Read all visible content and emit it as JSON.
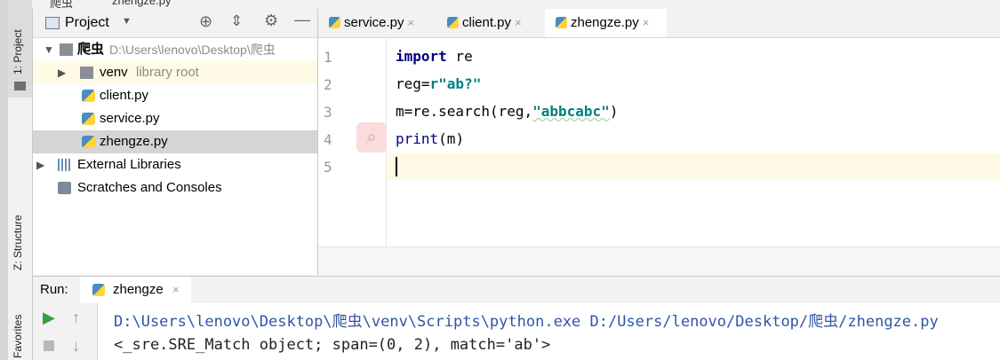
{
  "breadcrumb": {
    "project": "爬虫",
    "file": "zhengze.py"
  },
  "tool_windows": {
    "project": "1: Project",
    "structure": "Z: Structure",
    "favorites": "Favorites"
  },
  "project_panel": {
    "title": "Project",
    "tree": {
      "root": {
        "name": "爬虫",
        "path": "D:\\Users\\lenovo\\Desktop\\爬虫"
      },
      "venv": {
        "name": "venv",
        "note": "library root"
      },
      "files": [
        "client.py",
        "service.py",
        "zhengze.py"
      ],
      "external": "External Libraries",
      "scratches": "Scratches and Consoles"
    }
  },
  "editor": {
    "tabs": [
      {
        "label": "service.py",
        "close": "×"
      },
      {
        "label": "client.py",
        "close": "×"
      },
      {
        "label": "zhengze.py",
        "close": "×"
      }
    ],
    "line_numbers": [
      "1",
      "2",
      "3",
      "4",
      "5"
    ],
    "lines": {
      "l1": {
        "kw": "import",
        "rest": " re"
      },
      "l2": {
        "pre": "reg=",
        "str": "r\"ab?\""
      },
      "l3": {
        "pre": "m=re.search(reg,",
        "str": "\"abbcabc\"",
        "post": ")"
      },
      "l4": {
        "fn": "print",
        "rest": "(m)"
      }
    }
  },
  "run": {
    "label": "Run:",
    "tab": "zhengze",
    "tab_close": "×",
    "output": [
      "D:\\Users\\lenovo\\Desktop\\爬虫\\venv\\Scripts\\python.exe D:/Users/lenovo/Desktop/爬虫/zhengze.py",
      "<_sre.SRE_Match object; span=(0, 2), match='ab'>"
    ]
  },
  "colors": {
    "keyword": "#000080",
    "string": "#008080",
    "current_line": "#fefae5",
    "selected_row": "#d5d5d5",
    "run_green": "#3a9c3a"
  }
}
